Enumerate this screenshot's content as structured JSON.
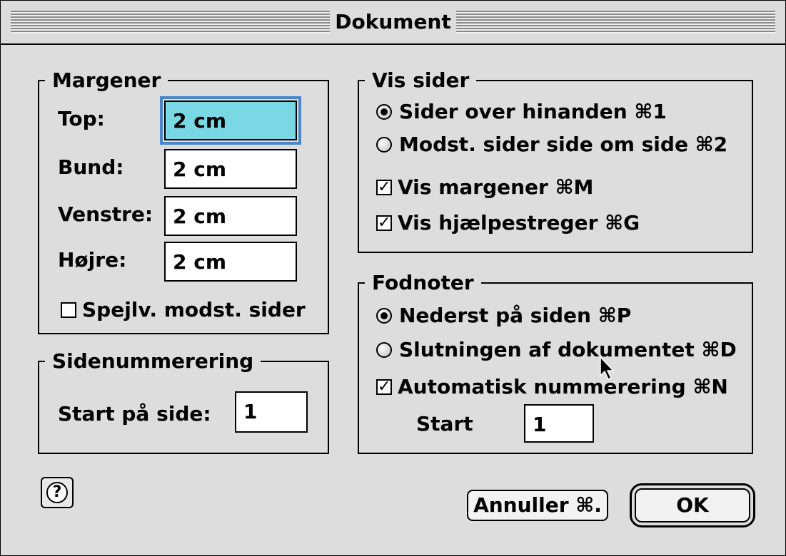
{
  "window": {
    "title": "Dokument"
  },
  "margins": {
    "legend": "Margener",
    "top_label": "Top:",
    "top_value": "2 cm",
    "bottom_label": "Bund:",
    "bottom_value": "2 cm",
    "left_label": "Venstre:",
    "left_value": "2 cm",
    "right_label": "Højre:",
    "right_value": "2 cm",
    "mirror_label": "Spejlv. modst. sider",
    "mirror_checked": false
  },
  "page_numbering": {
    "legend": "Sidenummerering",
    "start_label": "Start på side:",
    "start_value": "1"
  },
  "view_pages": {
    "legend": "Vis sider",
    "options": [
      {
        "label": "Sider over hinanden ⌘1",
        "selected": true
      },
      {
        "label": "Modst. sider side om side ⌘2",
        "selected": false
      }
    ],
    "show_margins": {
      "label": "Vis margener ⌘M",
      "checked": true
    },
    "show_guides": {
      "label": "Vis hjælpestreger ⌘G",
      "checked": true
    }
  },
  "footnotes": {
    "legend": "Fodnoter",
    "options": [
      {
        "label": "Nederst på siden ⌘P",
        "selected": true
      },
      {
        "label": "Slutningen af dokumentet ⌘D",
        "selected": false
      }
    ],
    "auto_numbering": {
      "label": "Automatisk nummerering ⌘N",
      "checked": true
    },
    "start_label": "Start",
    "start_value": "1"
  },
  "buttons": {
    "cancel": "Annuller ⌘.",
    "ok": "OK",
    "help_icon": "?"
  },
  "colors": {
    "focus_field": "#7ad8e4",
    "focus_ring": "#4a86c8",
    "window_bg": "#dddddd"
  }
}
